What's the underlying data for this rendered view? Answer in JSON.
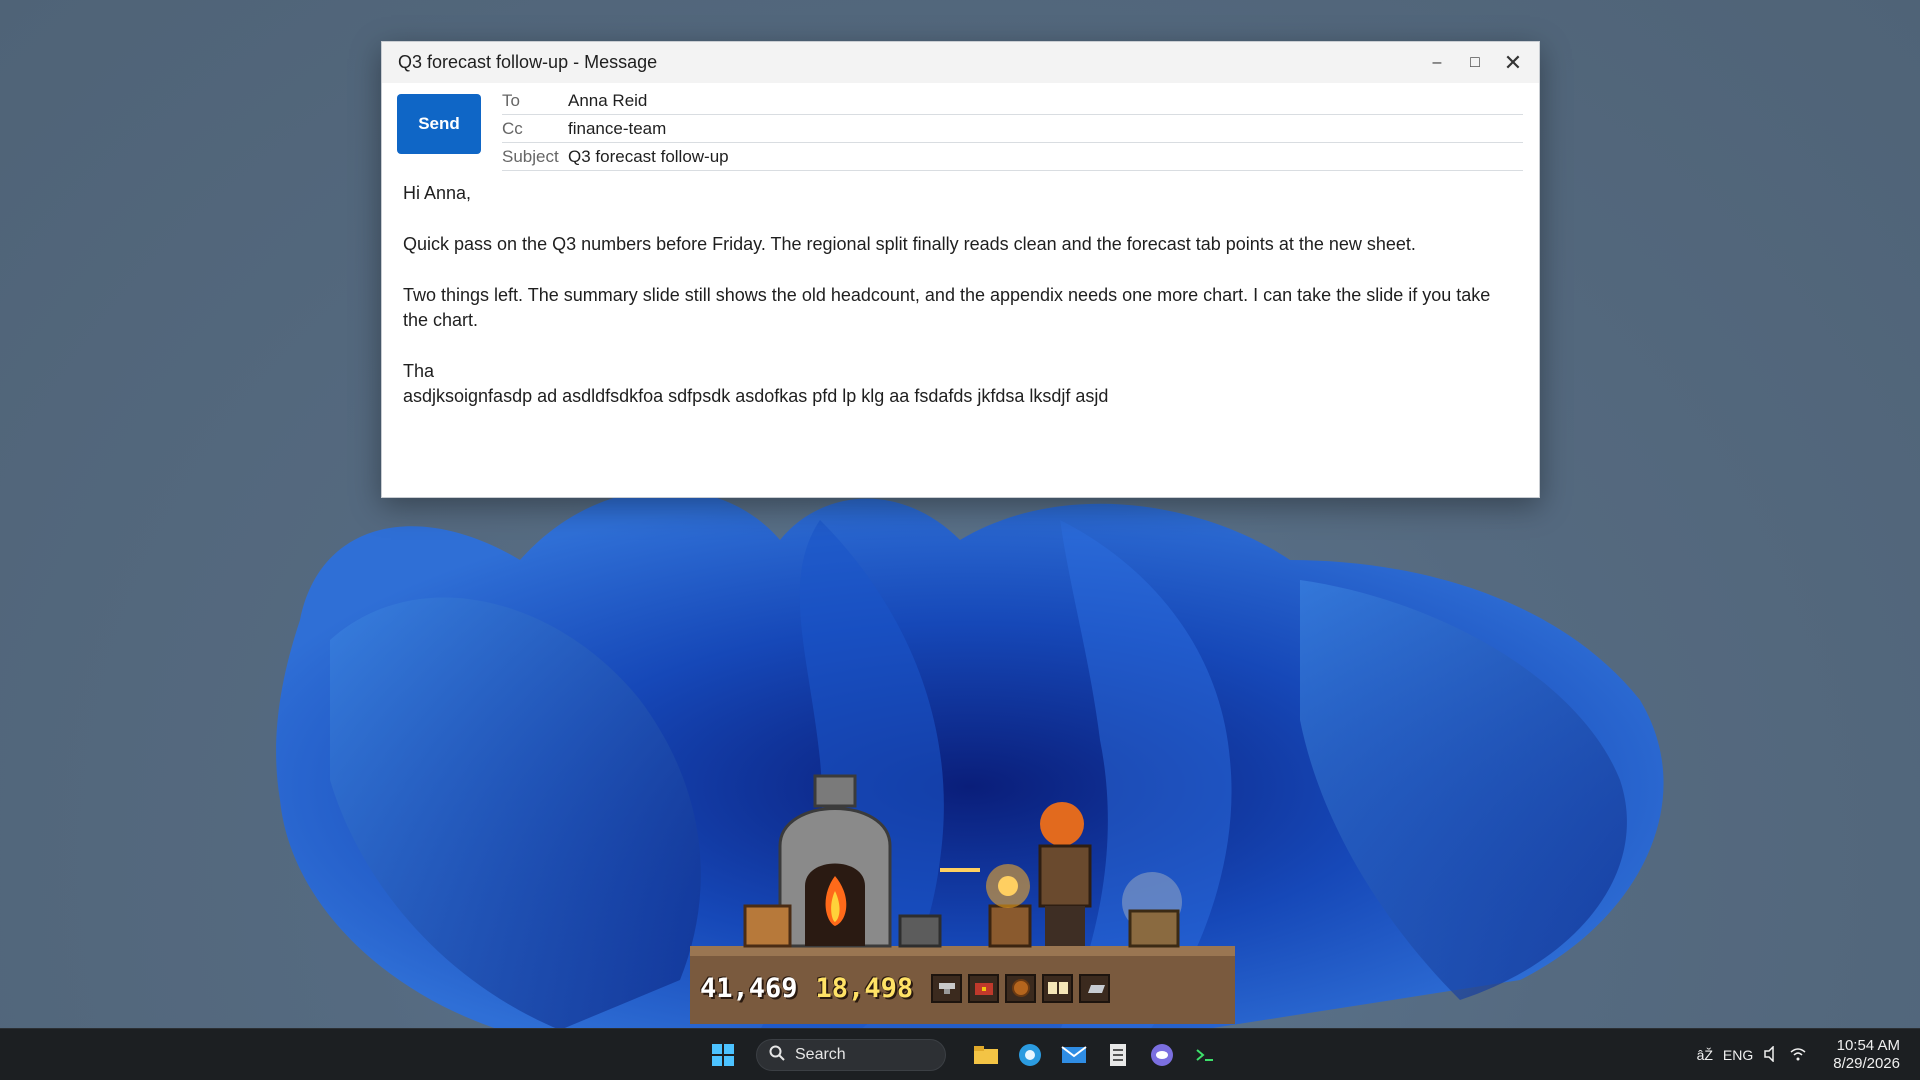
{
  "window": {
    "title": "Q3 forecast follow-up - Message",
    "minimize": "–",
    "maximize": "□",
    "close": "✕"
  },
  "compose": {
    "send_label": "Send",
    "to_label": "To",
    "to_value": "Anna Reid",
    "cc_label": "Cc",
    "cc_value": "finance-team",
    "subject_label": "Subject",
    "subject_value": "Q3 forecast follow-up"
  },
  "body": {
    "greeting": "Hi Anna,",
    "para1": "Quick pass on the Q3 numbers before Friday. The regional split finally reads clean and the forecast tab points at the new sheet.",
    "para2": "Two things left. The summary slide still shows the old headcount, and the appendix needs one more chart. I can take the slide if you take the chart.",
    "line3": "Tha",
    "line4": "asdjksoignfasdp ad asdldfsdkfoa sdfpsdk asdofkas pfd lp klg aa fsdafds jkfdsa lksdjf asjd"
  },
  "game": {
    "hammers": "41,469",
    "gold": "18,498",
    "slots": [
      "anvil-icon",
      "chest-icon",
      "shield-icon",
      "book-icon",
      "ingot-icon"
    ]
  },
  "taskbar": {
    "search_placeholder": "Search",
    "apps": [
      "file-explorer-icon",
      "edge-icon",
      "mail-icon",
      "notepad-icon",
      "chat-icon",
      "terminal-icon"
    ],
    "language_input": "âŽ",
    "language": "ENG",
    "time": "10:54 AM",
    "date": "8/29/2026"
  },
  "colors": {
    "accent": "#0f66c6",
    "taskbar": "#1c1f22",
    "desktop": "#556a80"
  }
}
